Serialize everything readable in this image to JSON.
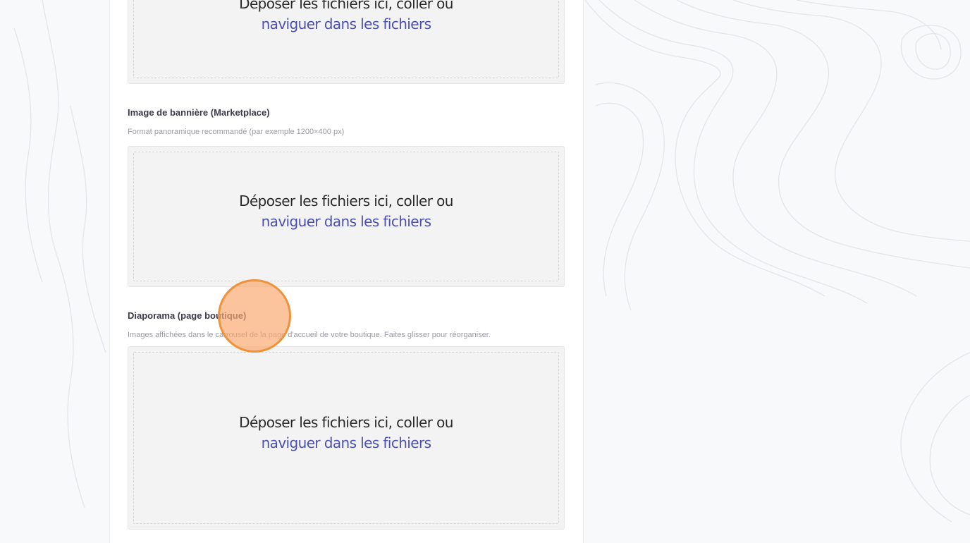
{
  "uploads": [
    {
      "label": "",
      "help": "",
      "drop_text": "Déposer les fichiers ici, coller ou",
      "browse_link": "naviguer dans les fichiers"
    },
    {
      "label": "Image de bannière (Marketplace)",
      "help": "Format panoramique recommandé (par exemple 1200×400 px)",
      "drop_text": "Déposer les fichiers ici, coller ou",
      "browse_link": "naviguer dans les fichiers"
    },
    {
      "label": "Diaporama (page boutique)",
      "help": "Images affichées dans le carrousel de la page d'accueil de votre boutique. Faites glisser pour réorganiser.",
      "drop_text": "Déposer les fichiers ici, coller ou",
      "browse_link": "naviguer dans les fichiers"
    }
  ],
  "colors": {
    "link": "#4b4fb0",
    "cursor_highlight": "#f0923a"
  }
}
